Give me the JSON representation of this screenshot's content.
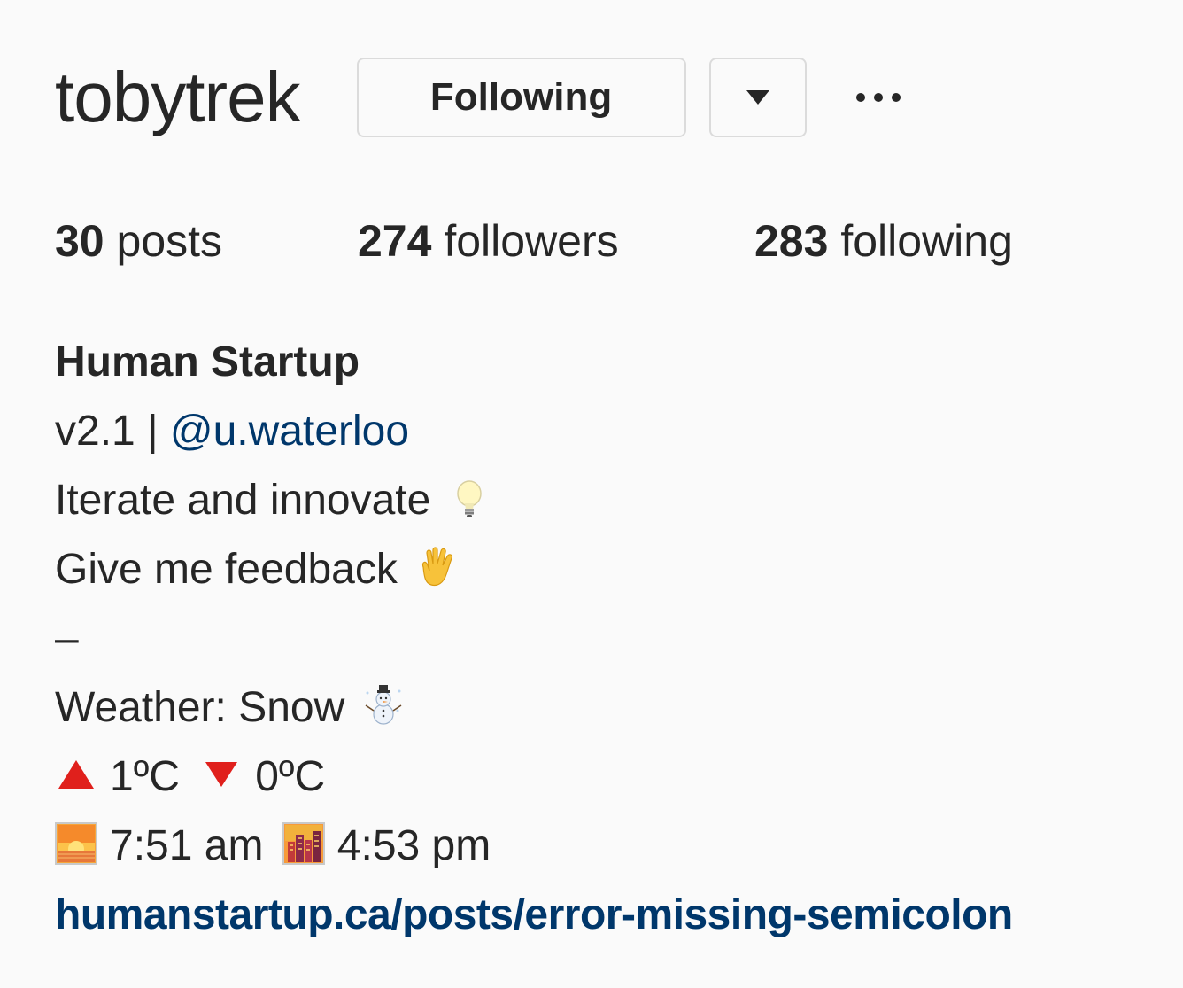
{
  "profile": {
    "username": "tobytrek",
    "following_button_label": "Following",
    "dropdown_icon": "triangle-down-icon",
    "more_icon": "ellipsis-icon"
  },
  "stats": {
    "posts_count": "30",
    "posts_label": "posts",
    "followers_count": "274",
    "followers_label": "followers",
    "following_count": "283",
    "following_label": "following"
  },
  "bio": {
    "name": "Human Startup",
    "version": "v2.1 |",
    "mention": "@u.waterloo",
    "line_iterate": "Iterate and innovate",
    "line_feedback": "Give me feedback",
    "separator": "–",
    "weather": "Weather: Snow",
    "temp_high": "1ºC",
    "temp_low": "0ºC",
    "sunrise": "7:51 am",
    "sunset": "4:53 pm",
    "website": "humanstartup.ca/posts/error-missing-semicolon",
    "emojis": {
      "iterate": "lightbulb-icon",
      "feedback": "vulcan-salute-icon",
      "weather": "snowman-icon",
      "high": "red-triangle-up-icon",
      "low": "red-triangle-down-icon",
      "sunrise": "sunrise-icon",
      "sunset": "city-sunset-icon"
    }
  },
  "colors": {
    "background": "#fafafa",
    "text": "#262626",
    "link": "#00376b",
    "border": "#dbdbdb"
  }
}
